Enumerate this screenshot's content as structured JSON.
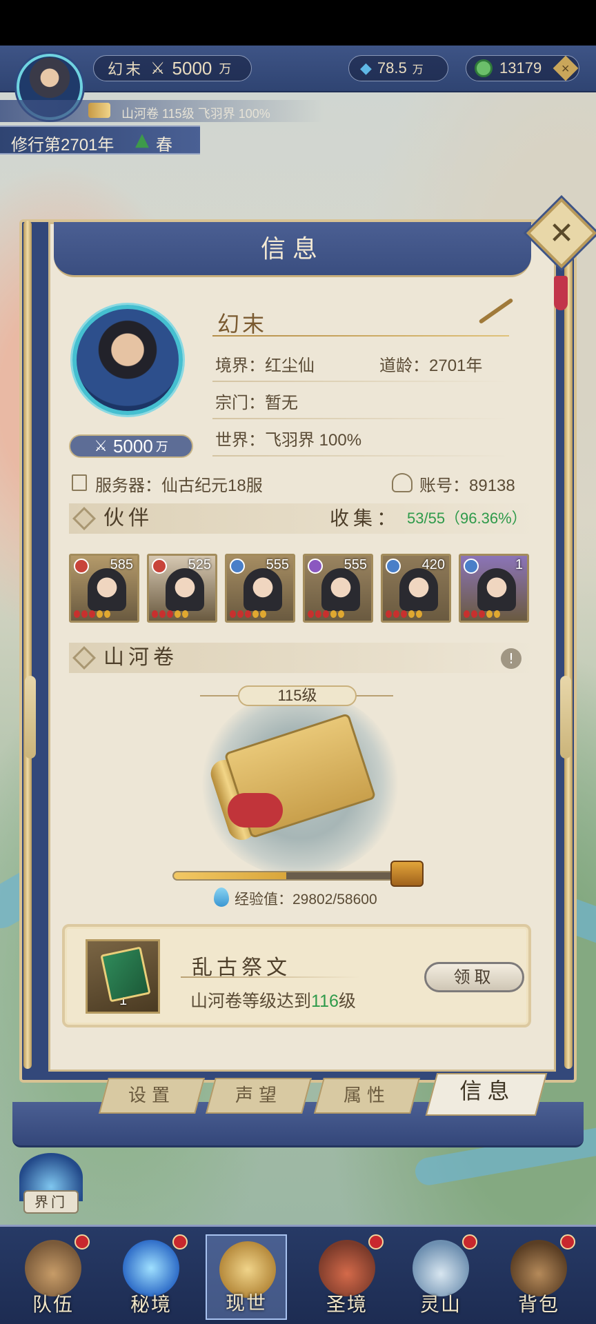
{
  "top_bar": {
    "player_name": "幻末",
    "power": "5000",
    "power_unit": "万",
    "spirit_stones": "78.5",
    "spirit_unit": "万",
    "jade": "13179",
    "plus_label": "+"
  },
  "sub_bar": {
    "scroll_info": "山河卷 115级 飞羽界 100%",
    "cultivation_year": "修行第2701年",
    "season": "春"
  },
  "panel": {
    "title": "信息",
    "close_label": "✕"
  },
  "profile": {
    "name": "幻末",
    "realm_label": "境界：红尘仙",
    "age_label": "道龄：2701年",
    "sect_label": "宗门：暂无",
    "world_label": "世界：飞羽界  100%",
    "power": "5000",
    "power_unit": "万",
    "server_label": "服务器：仙古纪元18服",
    "account_label": "账号：89138"
  },
  "partners": {
    "title": "伙伴",
    "collect_label": "收集：",
    "collect_value": "53/55（96.36%）",
    "cards": [
      {
        "level": "585",
        "element_color": "#c8443a",
        "bg": "#b49a6a"
      },
      {
        "level": "525",
        "element_color": "#c8443a",
        "bg": "#d6c8b2"
      },
      {
        "level": "555",
        "element_color": "#4a7fc8",
        "bg": "#a68d62"
      },
      {
        "level": "555",
        "element_color": "#8b58c0",
        "bg": "#9a8460"
      },
      {
        "level": "420",
        "element_color": "#4a7fc8",
        "bg": "#8f7a58"
      },
      {
        "level": "1",
        "element_color": "#4a7fc8",
        "bg": "#8b74b8"
      }
    ]
  },
  "mountain_scroll": {
    "title": "山河卷",
    "info_icon": "!",
    "level": "115级",
    "xp_label": "经验值：29802/58600",
    "xp_fraction": 0.508
  },
  "reward": {
    "title": "乱古祭文",
    "count": "1",
    "desc_prefix": "山河卷等级达到",
    "desc_level": "116",
    "desc_suffix": "级",
    "claim_label": "领取"
  },
  "tabs": [
    {
      "label": "设置"
    },
    {
      "label": "声望"
    },
    {
      "label": "属性"
    },
    {
      "label": "信息"
    }
  ],
  "world_gate": {
    "label": "界门"
  },
  "nav": [
    {
      "label": "队伍",
      "icon": "team-icon"
    },
    {
      "label": "秘境",
      "icon": "secret-realm-icon"
    },
    {
      "label": "现世",
      "icon": "present-world-icon"
    },
    {
      "label": "圣境",
      "icon": "holy-realm-icon"
    },
    {
      "label": "灵山",
      "icon": "spirit-mountain-icon"
    },
    {
      "label": "背包",
      "icon": "backpack-icon"
    }
  ],
  "colors": {
    "accent_green": "#2e9a4a",
    "header_blue": "#3e5486",
    "gold": "#c9b07c"
  }
}
